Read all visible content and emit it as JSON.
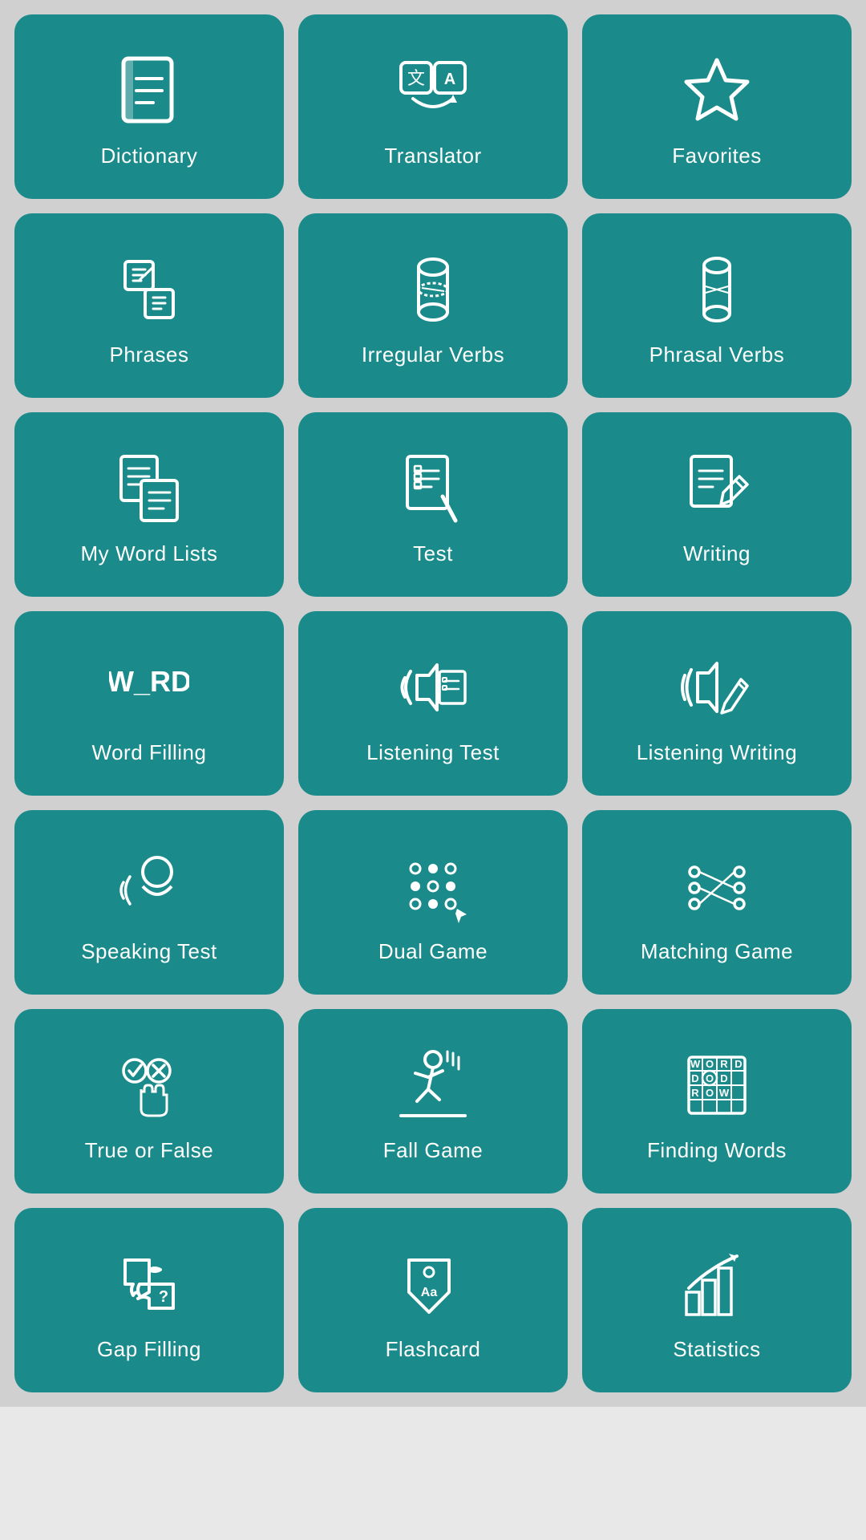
{
  "cards": [
    {
      "id": "dictionary",
      "label": "Dictionary"
    },
    {
      "id": "translator",
      "label": "Translator"
    },
    {
      "id": "favorites",
      "label": "Favorites"
    },
    {
      "id": "phrases",
      "label": "Phrases"
    },
    {
      "id": "irregular-verbs",
      "label": "Irregular Verbs"
    },
    {
      "id": "phrasal-verbs",
      "label": "Phrasal Verbs"
    },
    {
      "id": "my-word-lists",
      "label": "My Word Lists"
    },
    {
      "id": "test",
      "label": "Test"
    },
    {
      "id": "writing",
      "label": "Writing"
    },
    {
      "id": "word-filling",
      "label": "Word Filling"
    },
    {
      "id": "listening-test",
      "label": "Listening Test"
    },
    {
      "id": "listening-writing",
      "label": "Listening Writing"
    },
    {
      "id": "speaking-test",
      "label": "Speaking Test"
    },
    {
      "id": "dual-game",
      "label": "Dual Game"
    },
    {
      "id": "matching-game",
      "label": "Matching Game"
    },
    {
      "id": "true-or-false",
      "label": "True or False"
    },
    {
      "id": "fall-game",
      "label": "Fall Game"
    },
    {
      "id": "finding-words",
      "label": "Finding Words"
    },
    {
      "id": "gap-filling",
      "label": "Gap Filling"
    },
    {
      "id": "flashcard",
      "label": "Flashcard"
    },
    {
      "id": "statistics",
      "label": "Statistics"
    }
  ]
}
